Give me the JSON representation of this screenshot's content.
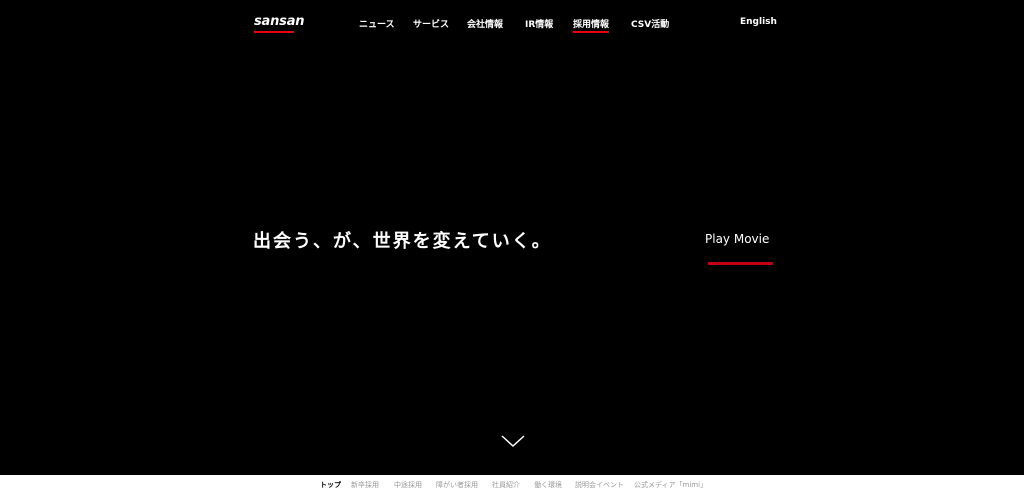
{
  "header": {
    "logo": "sansan",
    "nav": [
      {
        "label": "ニュース"
      },
      {
        "label": "サービス"
      },
      {
        "label": "会社情報"
      },
      {
        "label": "IR情報"
      },
      {
        "label": "採用情報"
      },
      {
        "label": "CSV活動"
      }
    ],
    "active_nav": "採用情報",
    "lang_link": "English"
  },
  "hero": {
    "tagline": "出会う、が、世界を変えていく。",
    "play_movie": "Play Movie"
  },
  "subnav": {
    "items": [
      {
        "label": "トップ"
      },
      {
        "label": "新卒採用"
      },
      {
        "label": "中途採用"
      },
      {
        "label": "障がい者採用"
      },
      {
        "label": "社員紹介"
      },
      {
        "label": "働く環境"
      },
      {
        "label": "説明会イベント"
      },
      {
        "label": "公式メディア「mimi」"
      }
    ],
    "active": "トップ"
  },
  "icons": {
    "scroll": "chevron-down-icon"
  },
  "colors": {
    "background": "#000000",
    "accent": "#e60012",
    "subnav_bg": "#ffffff",
    "subnav_text": "#9a9a9a"
  }
}
